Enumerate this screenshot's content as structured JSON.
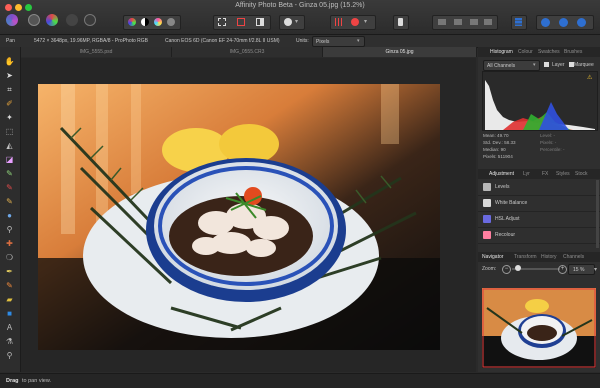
{
  "window": {
    "title": "Affinity Photo Beta - Ginza 05.jpg (15.2%)"
  },
  "context_bar": {
    "tool": "Pan",
    "doc_info": "5472 × 3648px, 19.96MP, RGBA/8 - ProPhoto RGB",
    "camera_info": "Canon EOS 6D (Canon EF 24-70mm f/2.8L II USM)",
    "units_label": "Units:",
    "units_value": "Pixels"
  },
  "doc_tabs": [
    "IMG_5555.psd",
    "IMG_0555.CR3",
    "Ginza 05.jpg"
  ],
  "histogram_panel": {
    "tabs": [
      "Histogram",
      "Colour",
      "Swatches",
      "Brushes"
    ],
    "channel_select": "All Channels",
    "layer_label": "Layer",
    "marquee_label": "Marquee",
    "warning": "⚠",
    "stats": {
      "mean": "Mean: 49.70",
      "std_dev": "Std. Dev.: 58.33",
      "median": "Median: 90",
      "pixels": "Pixels: 511904",
      "level": "Level: -",
      "pixels_cursor": "Pixels: -",
      "percentile": "Percentile: -"
    }
  },
  "adjustment_panel": {
    "tabs": [
      "Adjustment",
      "Lyr",
      "FX",
      "Styles",
      "Stock"
    ],
    "items": [
      {
        "label": "Levels",
        "color": "#b7b7b7"
      },
      {
        "label": "White Balance",
        "color": "#d9d9d9"
      },
      {
        "label": "HSL Adjust",
        "color": "#6a6ae0"
      },
      {
        "label": "Recolour",
        "color": "#ff7fa0"
      }
    ]
  },
  "navigator_panel": {
    "tabs": [
      "Navigator",
      "Transform",
      "History",
      "Channels"
    ],
    "zoom_label": "Zoom:",
    "zoom_minus": "−",
    "zoom_plus": "+",
    "zoom_value": "15 %"
  },
  "status_bar": {
    "hint_bold": "Drag",
    "hint_text": " to pan view."
  },
  "colors": {
    "accent": "#2e6fd1",
    "panel_bg": "#2f2f2f",
    "app_bg": "#2a2a2a"
  }
}
